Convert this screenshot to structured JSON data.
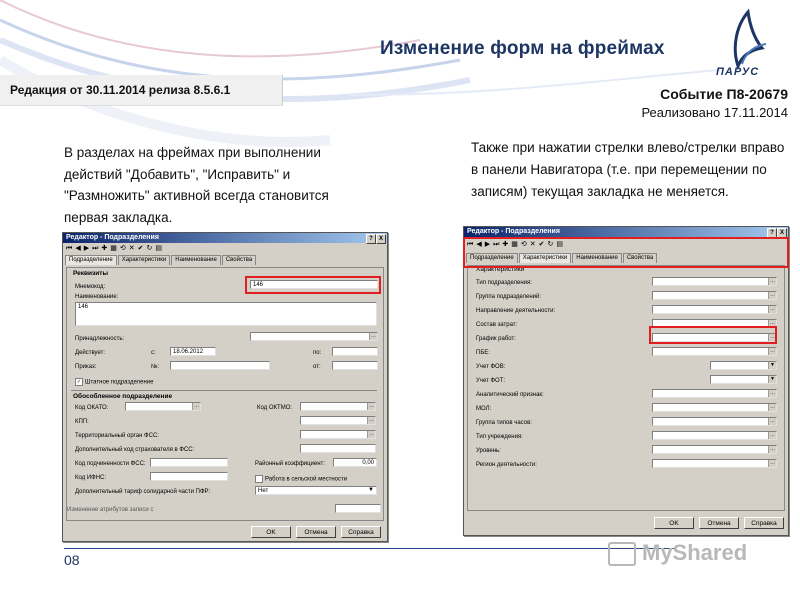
{
  "header": {
    "title": "Изменение форм на фреймах",
    "logo_text": "ПАРУС",
    "edition": "Редакция от 30.11.2014 релиза 8.5.6.1",
    "event": "Событие П8-20679",
    "implemented": "Реализовано 17.11.2014"
  },
  "left_text": "В разделах на фреймах при выполнении действий \"Добавить\", \"Исправить\" и \"Размножить\" активной всегда становится первая закладка.",
  "right_text": "Также при нажатии стрелки влево/стрелки вправо в панели Навигатора (т.е. при перемещении по записям) текущая закладка  не меняется.",
  "footer": {
    "page_number": "08",
    "watermark": "MyShared"
  },
  "dialog_left": {
    "title": "Редактор - Подразделения",
    "help_btn": "?",
    "close_btn": "X",
    "nav_icons": [
      "first-icon",
      "prev-icon",
      "next-icon",
      "last-icon",
      "add-icon",
      "grid-icon",
      "refresh-icon",
      "delete-icon",
      "check-icon",
      "redo-icon",
      "export-icon"
    ],
    "tabs": [
      "Подразделение",
      "Характеристики",
      "Наименование",
      "Свойства"
    ],
    "section_requisites": "Реквизиты",
    "mnemocode_label": "Мнемокод:",
    "mnemocode_value": "146",
    "name_label": "Наименование:",
    "name_value": "146",
    "belonging_label": "Принадлежность:",
    "acts_label": "Действует:",
    "from_label": "с:",
    "from_value": "18.06.2012",
    "to_label": "по:",
    "order_label": "Приказ:",
    "no_label": "№:",
    "from2_label": "от:",
    "staff_checkbox": "Штатное подразделение",
    "section_separate": "Обособленное подразделение",
    "okato_label": "Код ОКАТО:",
    "oktmo_label": "Код ОКТМО:",
    "kpp_label": "КПП:",
    "fss_label": "Территориальный орган ФСС:",
    "insurer_label": "Дополнительный код страхователя в ФСС:",
    "subordination_label": "Код подчиненности ФСС:",
    "district_label": "Районный коэффициент:",
    "district_value": "0,00",
    "ifns_label": "Код ИФНС:",
    "rural_label": "Работа в сельской местности",
    "pfr_label": "Дополнительный тариф солидарной части ПФР:",
    "pfr_value": "Нет",
    "status_text": "Изменение атрибутов записи с",
    "ok": "OK",
    "cancel": "Отмена",
    "help": "Справка"
  },
  "dialog_right": {
    "title": "Редактор - Подразделения",
    "help_btn": "?",
    "close_btn": "X",
    "tabs": [
      "Подразделение",
      "Характеристики",
      "Наименование",
      "Свойства"
    ],
    "section": "Характеристики",
    "fields": [
      "Тип подразделения:",
      "Группа подразделений:",
      "Направление деятельности:",
      "Состав затрат:",
      "График работ:",
      "ПБЕ:",
      "Учет ФОВ:",
      "Учет ФОТ:",
      "Аналитический признак:",
      "МОЛ:",
      "Группа типов часов:",
      "Тип учреждения:",
      "Уровень:",
      "Регион деятельности:"
    ],
    "ok": "OK",
    "cancel": "Отмена",
    "help": "Справка"
  },
  "colors": {
    "title": "#1d3563",
    "highlight": "#e02020",
    "dialog_bg": "#d4d0c8"
  }
}
